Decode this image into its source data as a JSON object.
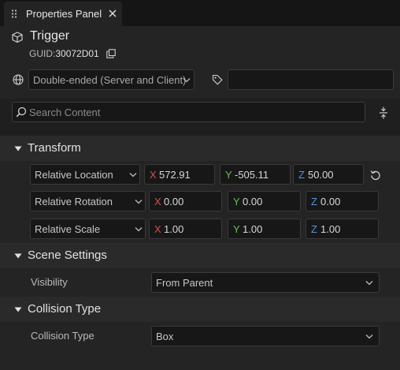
{
  "tab": {
    "title": "Properties Panel",
    "close_icon": "close-icon",
    "grip_icon": "grip-icon"
  },
  "header": {
    "title": "Trigger",
    "guid_label": "GUID:",
    "guid_value": "30072D01",
    "network_mode": "Double-ended (Server and Client)",
    "tags_value": ""
  },
  "search": {
    "placeholder": "Search Content",
    "value": ""
  },
  "sections": {
    "transform": {
      "title": "Transform",
      "rows": [
        {
          "mode": "Relative Location",
          "x": "572.91",
          "y": "-505.11",
          "z": "50.00"
        },
        {
          "mode": "Relative Rotation",
          "x": "0.00",
          "y": "0.00",
          "z": "0.00"
        },
        {
          "mode": "Relative Scale",
          "x": "1.00",
          "y": "1.00",
          "z": "1.00"
        }
      ],
      "axis_labels": {
        "x": "X",
        "y": "Y",
        "z": "Z"
      }
    },
    "scene": {
      "title": "Scene Settings",
      "visibility_label": "Visibility",
      "visibility_value": "From Parent"
    },
    "collision": {
      "title": "Collision Type",
      "type_label": "Collision Type",
      "type_value": "Box"
    }
  },
  "colors": {
    "axis_x": "#d4534b",
    "axis_y": "#6dbb56",
    "axis_z": "#5b8edc",
    "panel_bg": "#242424",
    "section_bg": "#2a2a2a"
  }
}
